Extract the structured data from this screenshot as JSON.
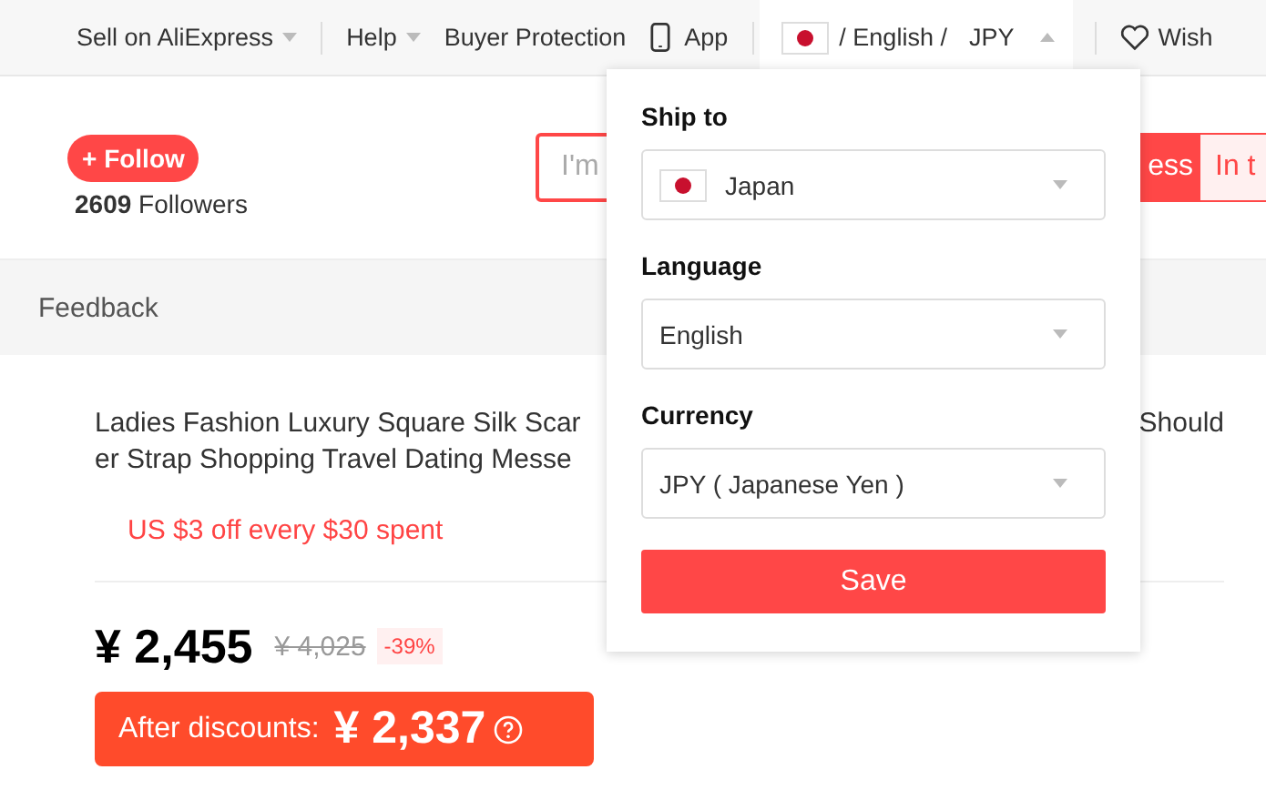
{
  "top_nav": {
    "items": [
      {
        "kind": "dropdown",
        "label": "Sell on AliExpress"
      },
      {
        "kind": "dropdown",
        "label": "Help"
      },
      {
        "kind": "link",
        "label": "Buyer Protection"
      },
      {
        "kind": "app",
        "label": "App"
      }
    ],
    "locale": {
      "language": "/ English /",
      "currency": "JPY",
      "expanded": true
    },
    "wishlist": "Wish"
  },
  "store": {
    "follow_button": "+ Follow",
    "followers_count": "2609",
    "followers_label": "Followers",
    "search": {
      "placeholder": "I'm"
    },
    "buttons": [
      {
        "kind": "primary",
        "label": "ess"
      },
      {
        "kind": "secondary",
        "label": "In t"
      }
    ]
  },
  "tab_bar": {
    "label": "Feedback"
  },
  "product": {
    "title_lines": [
      "Ladies Fashion Luxury Square Silk Scar",
      "er Strap Shopping Travel Dating Messe"
    ],
    "title_right": "Should",
    "promo": "US $3 off every $30 spent",
    "price": "¥ 2,455",
    "original_price": "¥ 4,025",
    "discount": "-39%",
    "after_label": "After discounts:",
    "after_price": "¥ 2,337"
  },
  "popup": {
    "ship_to_label": "Ship to",
    "country": "Japan",
    "language_label": "Language",
    "language": "English",
    "currency_label": "Currency",
    "currency": "JPY ( Japanese Yen )",
    "save_button": "Save"
  }
}
